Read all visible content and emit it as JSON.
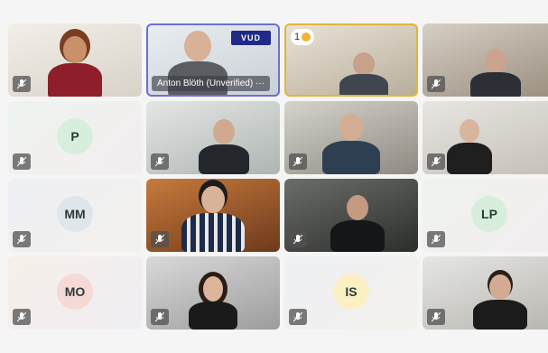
{
  "meeting": {
    "tiles": [
      {
        "kind": "video"
      },
      {
        "kind": "video",
        "name": "Anton Blöth (Unverified)",
        "more": "···",
        "logo": "VUD"
      },
      {
        "kind": "video",
        "reaction": "1"
      },
      {
        "kind": "video"
      },
      {
        "kind": "avatar",
        "initials": "P",
        "avatar_color": "#d7eedc"
      },
      {
        "kind": "video"
      },
      {
        "kind": "video"
      },
      {
        "kind": "video"
      },
      {
        "kind": "avatar",
        "initials": "MM",
        "avatar_color": "#dfe6ea"
      },
      {
        "kind": "video"
      },
      {
        "kind": "video"
      },
      {
        "kind": "avatar",
        "initials": "LP",
        "avatar_color": "#d8eedd"
      },
      {
        "kind": "avatar",
        "initials": "MO",
        "avatar_color": "#f4d9d6"
      },
      {
        "kind": "video"
      },
      {
        "kind": "avatar",
        "initials": "IS",
        "avatar_color": "#fbefc4"
      },
      {
        "kind": "video"
      }
    ]
  },
  "colors": {
    "active_speaker_border": "#6a6fd6",
    "reaction_border": "#e3b43a",
    "mic_badge": "#505050"
  },
  "icons": {
    "mic": "microphone-muted-icon",
    "reaction": "raised-hand-icon"
  }
}
